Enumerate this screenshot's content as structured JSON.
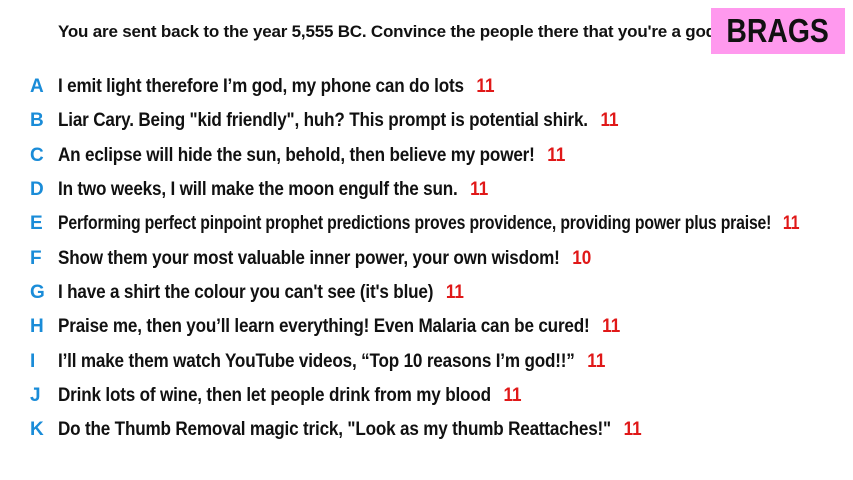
{
  "prompt": "You are sent back to the year 5,555 BC. Convince the people there that you're a god.",
  "category_badge": {
    "label": "BRAGS",
    "color": "#ff99ee"
  },
  "colors": {
    "letter": "#1a8cd8",
    "score": "#e01818",
    "text": "#111111"
  },
  "answers": [
    {
      "letter": "A",
      "text": "I emit light therefore I’m god, my phone can do lots",
      "score": "11"
    },
    {
      "letter": "B",
      "text": "Liar Cary. Being \"kid friendly\", huh? This prompt is potential shirk.",
      "score": "11"
    },
    {
      "letter": "C",
      "text": "An eclipse will hide the sun, behold, then believe my power!",
      "score": "11"
    },
    {
      "letter": "D",
      "text": "In two weeks, I will make the moon engulf the sun.",
      "score": "11"
    },
    {
      "letter": "E",
      "text": "Performing perfect pinpoint prophet predictions proves providence, providing power plus praise!",
      "score": "11"
    },
    {
      "letter": "F",
      "text": "Show them your most valuable inner power, your own wisdom!",
      "score": "10"
    },
    {
      "letter": "G",
      "text": "I have a shirt the colour you can't see (it's blue)",
      "score": "11"
    },
    {
      "letter": "H",
      "text": "Praise me, then you’ll learn everything! Even Malaria can be cured!",
      "score": "11"
    },
    {
      "letter": "I",
      "text": "I’ll make them watch YouTube videos, “Top 10 reasons I’m god!!”",
      "score": "11"
    },
    {
      "letter": "J",
      "text": "Drink lots of wine, then let people drink from my blood",
      "score": "11"
    },
    {
      "letter": "K",
      "text": "Do the Thumb Removal magic trick, \"Look as my thumb Reattaches!\"",
      "score": "11"
    }
  ]
}
